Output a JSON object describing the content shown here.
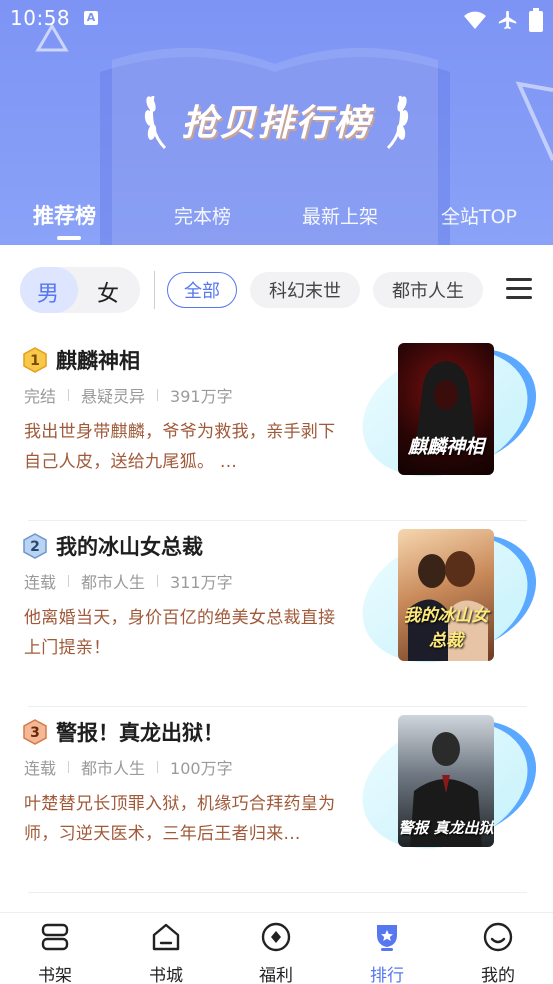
{
  "status_bar": {
    "time": "10:58",
    "indicator": "A"
  },
  "header": {
    "title": "抢贝排行榜",
    "tabs": [
      {
        "label": "推荐榜",
        "active": true
      },
      {
        "label": "完本榜",
        "active": false
      },
      {
        "label": "最新上架",
        "active": false
      },
      {
        "label": "全站TOP",
        "active": false
      }
    ]
  },
  "filters": {
    "gender": {
      "male": "男",
      "female": "女",
      "selected": "男"
    },
    "chips": [
      {
        "label": "全部",
        "active": true
      },
      {
        "label": "科幻末世",
        "active": false
      },
      {
        "label": "都市人生",
        "active": false
      }
    ]
  },
  "books": [
    {
      "rank": "1",
      "title": "麒麟神相",
      "status": "完结",
      "category": "悬疑灵异",
      "words": "391万字",
      "desc": "我出世身带麒麟，爷爷为救我，亲手剥下自己人皮，送给九尾狐。 ...",
      "cover_text": "麒麟神相"
    },
    {
      "rank": "2",
      "title": "我的冰山女总裁",
      "status": "连载",
      "category": "都市人生",
      "words": "311万字",
      "desc": "他离婚当天，身价百亿的绝美女总裁直接上门提亲！",
      "cover_text": "我的冰山女总裁"
    },
    {
      "rank": "3",
      "title": "警报！真龙出狱！",
      "status": "连载",
      "category": "都市人生",
      "words": "100万字",
      "desc": "叶楚替兄长顶罪入狱，机缘巧合拜药皇为师，习逆天医术，三年后王者归来...",
      "cover_text": "警报 真龙出狱"
    }
  ],
  "bottom_nav": [
    {
      "label": "书架",
      "icon": "bookshelf-icon",
      "active": false
    },
    {
      "label": "书城",
      "icon": "bookstore-icon",
      "active": false
    },
    {
      "label": "福利",
      "icon": "welfare-icon",
      "active": false
    },
    {
      "label": "排行",
      "icon": "ranking-icon",
      "active": true
    },
    {
      "label": "我的",
      "icon": "profile-icon",
      "active": false
    }
  ],
  "colors": {
    "header_bg": "#7d94f5",
    "accent": "#5677f0",
    "desc_text": "#a05a3a",
    "rank1": "#f5b82e",
    "rank2": "#7fa6d9",
    "rank3": "#e08a5a"
  }
}
